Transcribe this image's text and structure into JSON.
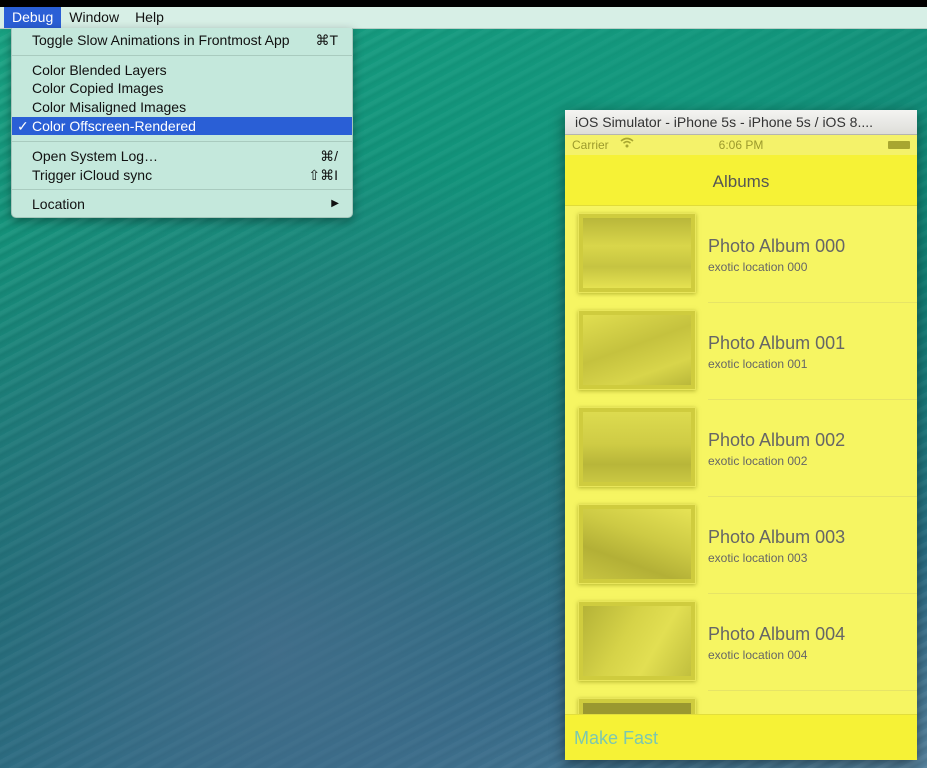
{
  "menubar": {
    "items": [
      {
        "label": "Debug",
        "active": true
      },
      {
        "label": "Window",
        "active": false
      },
      {
        "label": "Help",
        "active": false
      }
    ]
  },
  "debug_menu": {
    "toggle_slow": {
      "label": "Toggle Slow Animations in Frontmost App",
      "shortcut": "⌘T"
    },
    "color_blended": {
      "label": "Color Blended Layers"
    },
    "color_copied": {
      "label": "Color Copied Images"
    },
    "color_misaligned": {
      "label": "Color Misaligned Images"
    },
    "color_offscreen": {
      "label": "Color Offscreen-Rendered",
      "check": "✓"
    },
    "open_log": {
      "label": "Open System Log…",
      "shortcut": "⌘/"
    },
    "trigger_icloud": {
      "label": "Trigger iCloud sync",
      "shortcut": "⇧⌘I"
    },
    "location": {
      "label": "Location",
      "arrow": "▶"
    }
  },
  "simulator": {
    "title": "iOS Simulator - iPhone 5s - iPhone 5s / iOS 8....",
    "status": {
      "carrier": "Carrier",
      "time": "6:06 PM",
      "wifi_icon": "wifi-icon"
    },
    "nav_title": "Albums",
    "albums": [
      {
        "title": "Photo Album 000",
        "subtitle": "exotic location 000"
      },
      {
        "title": "Photo Album 001",
        "subtitle": "exotic location 001"
      },
      {
        "title": "Photo Album 002",
        "subtitle": "exotic location 002"
      },
      {
        "title": "Photo Album 003",
        "subtitle": "exotic location 003"
      },
      {
        "title": "Photo Album 004",
        "subtitle": "exotic location 004"
      }
    ],
    "toolbar_button": "Make Fast"
  },
  "colors": {
    "menu_highlight": "#2a5fd6",
    "offscreen_overlay": "#f4f26a"
  }
}
